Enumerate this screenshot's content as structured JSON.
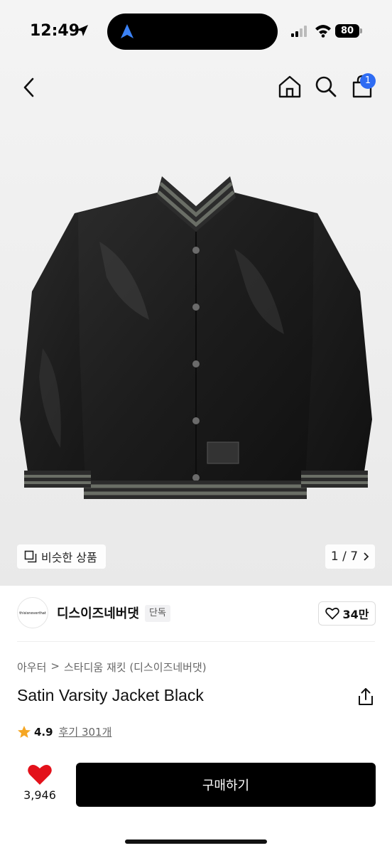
{
  "status_bar": {
    "time": "12:49",
    "battery": "80"
  },
  "cart": {
    "count": "1"
  },
  "image": {
    "similar_label": "비슷한 상품",
    "pager": "1 / 7"
  },
  "brand": {
    "name": "디스이즈네버댓",
    "badge": "단독",
    "logo_text": "thisisneverthat",
    "likes": "34만"
  },
  "breadcrumb": {
    "category": "아우터",
    "separator": ">",
    "subcategory": "스타디움 재킷 (디스이즈네버댓)"
  },
  "product": {
    "title": "Satin Varsity Jacket Black",
    "rating": "4.9",
    "reviews": "후기 301개"
  },
  "bottom_bar": {
    "like_count": "3,946",
    "buy_label": "구매하기"
  },
  "colors": {
    "accent": "#2f6cf3",
    "heart": "#e3111a",
    "star": "#f5a623",
    "buy_bg": "#000000"
  }
}
